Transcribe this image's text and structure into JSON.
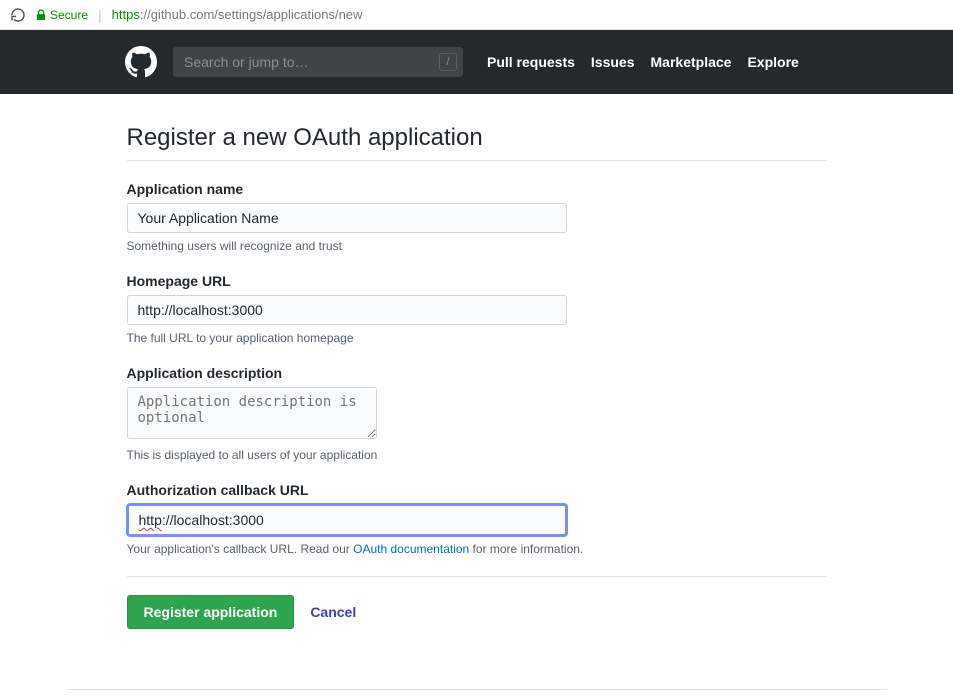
{
  "browser": {
    "secure_label": "Secure",
    "url_proto": "https",
    "url_rest": "://github.com/settings/applications/new"
  },
  "header": {
    "search_placeholder": "Search or jump to…",
    "search_key": "/",
    "nav": {
      "pull_requests": "Pull requests",
      "issues": "Issues",
      "marketplace": "Marketplace",
      "explore": "Explore"
    }
  },
  "page": {
    "title": "Register a new OAuth application"
  },
  "fields": {
    "app_name": {
      "label": "Application name",
      "value": "Your Application Name",
      "help": "Something users will recognize and trust"
    },
    "homepage": {
      "label": "Homepage URL",
      "value": "http://localhost:3000",
      "help": "The full URL to your application homepage"
    },
    "description": {
      "label": "Application description",
      "placeholder": "Application description is optional",
      "help": "This is displayed to all users of your application"
    },
    "callback": {
      "label": "Authorization callback URL",
      "value_prefix": "http",
      "value_rest": "://localhost:3000",
      "help_before": "Your application's callback URL. Read our ",
      "help_link": "OAuth documentation",
      "help_after": " for more information."
    }
  },
  "actions": {
    "submit": "Register application",
    "cancel": "Cancel"
  }
}
